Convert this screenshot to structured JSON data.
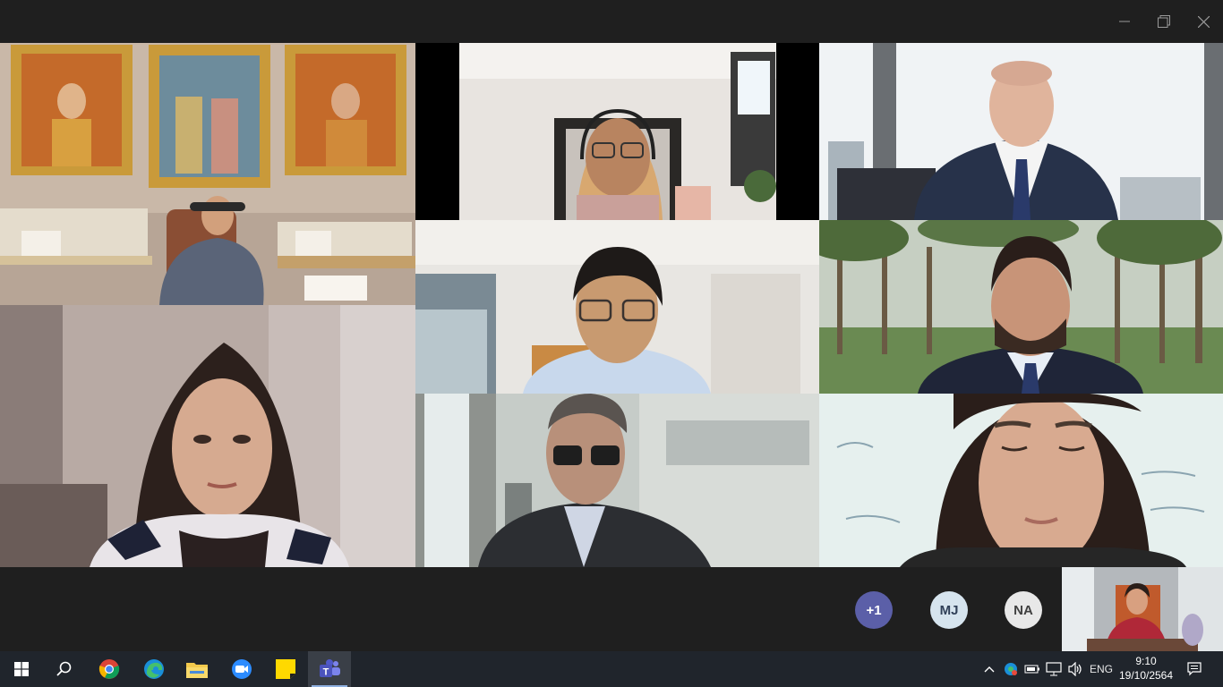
{
  "window": {
    "controls": {
      "minimize_icon": "minimize-icon",
      "restore_icon": "restore-icon",
      "close_icon": "close-icon"
    }
  },
  "participants": {
    "overflow_label": "+1",
    "avatars": [
      {
        "initials": "MJ",
        "color": "#dbe6f0"
      },
      {
        "initials": "NA",
        "color": "#e8e8e8"
      }
    ],
    "overflow_color": "#6264a7"
  },
  "taskbar": {
    "apps": [
      "start-icon",
      "search-icon",
      "chrome-icon",
      "edge-icon",
      "file-explorer-icon",
      "zoom-icon",
      "sticky-notes-icon",
      "teams-icon"
    ],
    "language": "ENG",
    "time": "9:10",
    "date": "19/10/2564"
  }
}
